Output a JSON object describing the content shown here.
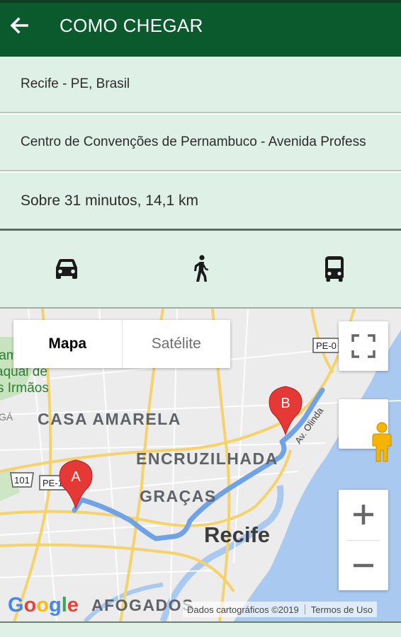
{
  "appbar": {
    "title": "COMO CHEGAR",
    "back_icon": "arrow-left-icon"
  },
  "route": {
    "origin": "Recife - PE, Brasil",
    "destination": "Centro de Convenções de Pernambuco - Avenida Profess",
    "summary": "Sobre 31 minutos, 14,1 km"
  },
  "modes": [
    {
      "name": "car",
      "icon": "car-icon"
    },
    {
      "name": "walk",
      "icon": "walk-icon"
    },
    {
      "name": "bus",
      "icon": "bus-icon"
    }
  ],
  "map": {
    "type_toggle": {
      "map_label": "Mapa",
      "satellite_label": "Satélite",
      "selected": "Mapa"
    },
    "labels": {
      "casa_amarela": "CASA AMARELA",
      "encruzilhada": "ENCRUZILHADA",
      "gracas": "GRAÇAS",
      "recife": "Recife",
      "afogados": "AFOGADOS",
      "av_olinda": "Av. Olinda",
      "partial_left_1": "ram",
      "partial_left_2": "aqual de",
      "partial_left_3": "s Irmãos",
      "partial_left_4": "GÁ",
      "road_101": "101",
      "road_pe_left": "PE-1",
      "road_pe_top": "PE-0"
    },
    "markers": {
      "start": "A",
      "end": "B"
    },
    "logo": "Google",
    "attribution": "Dados cartográficos ©2019",
    "terms": "Termos de Uso",
    "zoom_in": "+",
    "zoom_out": "−",
    "colors": {
      "route": "#6fa3e6",
      "marker": "#e53935",
      "water": "#a9c9f0",
      "land": "#ececec",
      "roads": "#f6d26b"
    }
  }
}
